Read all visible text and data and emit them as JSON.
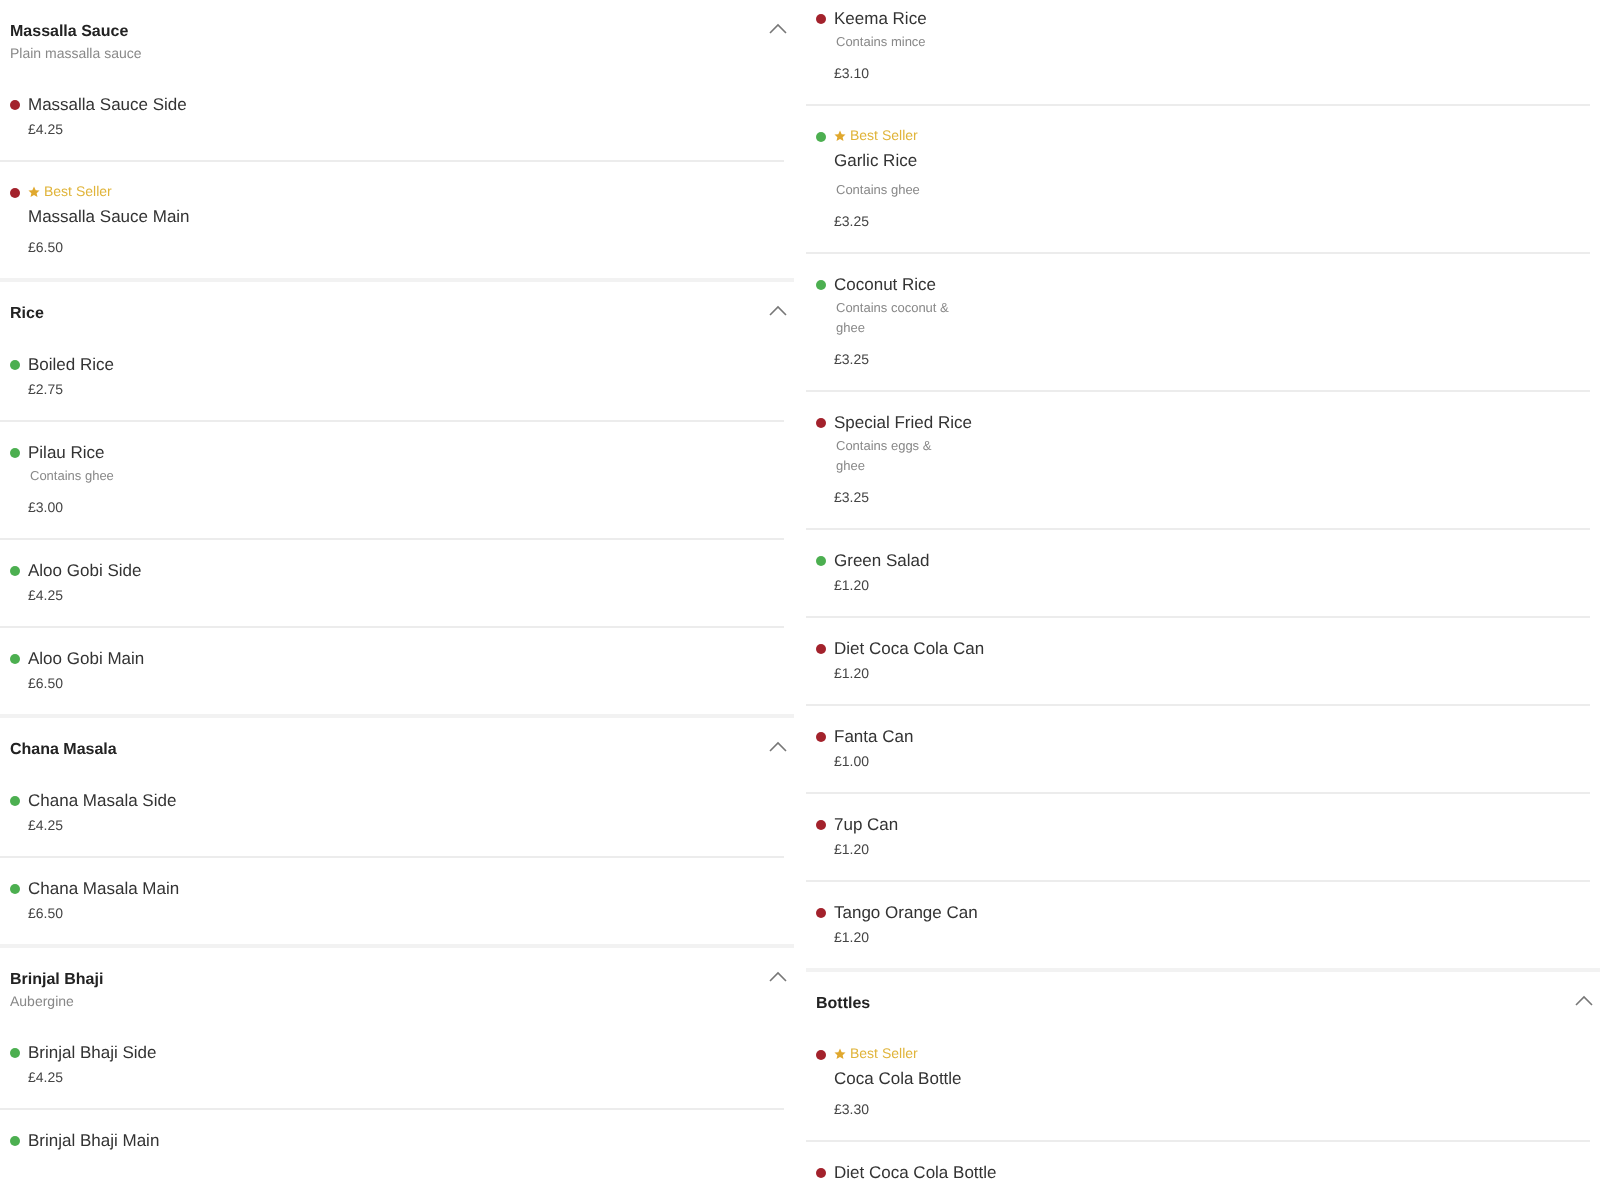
{
  "columns": [
    {
      "sections": [
        {
          "title": "Massalla Sauce",
          "subtitle": "Plain massalla sauce",
          "expanded": true,
          "items": [
            {
              "name": "Massalla Sauce Side",
              "price": "£4.25",
              "color": "#a3222c"
            },
            {
              "name": "Massalla Sauce Main",
              "price": "£6.50",
              "color": "#a3222c",
              "badge": "Best Seller"
            }
          ]
        },
        {
          "title": "Rice",
          "expanded": true,
          "items": [
            {
              "name": "Boiled Rice",
              "price": "£2.75",
              "color": "#4caf50"
            },
            {
              "name": "Pilau Rice",
              "description": "Contains ghee",
              "price": "£3.00",
              "color": "#4caf50"
            },
            {
              "name": "Aloo Gobi Side",
              "price": "£4.25",
              "color": "#4caf50"
            },
            {
              "name": "Aloo Gobi Main",
              "price": "£6.50",
              "color": "#4caf50"
            }
          ]
        },
        {
          "title": "Chana Masala",
          "expanded": true,
          "items": [
            {
              "name": "Chana Masala Side",
              "price": "£4.25",
              "color": "#4caf50"
            },
            {
              "name": "Chana Masala Main",
              "price": "£6.50",
              "color": "#4caf50"
            }
          ]
        },
        {
          "title": "Brinjal Bhaji",
          "subtitle": "Aubergine",
          "expanded": true,
          "items": [
            {
              "name": "Brinjal Bhaji Side",
              "price": "£4.25",
              "color": "#4caf50"
            },
            {
              "name": "Brinjal Bhaji Main",
              "color": "#4caf50"
            }
          ]
        }
      ]
    },
    {
      "sections": [
        {
          "items": [
            {
              "name": "Keema Rice",
              "description": "Contains mince",
              "price": "£3.10",
              "color": "#a3222c"
            },
            {
              "name": "Garlic Rice",
              "description": "Contains ghee",
              "price": "£3.25",
              "color": "#4caf50",
              "badge": "Best Seller"
            },
            {
              "name": "Coconut Rice",
              "description": "Contains coconut & ghee",
              "price": "£3.25",
              "color": "#4caf50"
            },
            {
              "name": "Special Fried Rice",
              "description": "Contains eggs & ghee",
              "price": "£3.25",
              "color": "#a3222c"
            },
            {
              "name": "Green Salad",
              "price": "£1.20",
              "color": "#4caf50"
            },
            {
              "name": "Diet Coca Cola Can",
              "price": "£1.20",
              "color": "#a3222c"
            },
            {
              "name": "Fanta Can",
              "price": "£1.00",
              "color": "#a3222c"
            },
            {
              "name": "7up Can",
              "price": "£1.20",
              "color": "#a3222c"
            },
            {
              "name": "Tango Orange Can",
              "price": "£1.20",
              "color": "#a3222c"
            }
          ]
        },
        {
          "title": "Bottles",
          "expanded": true,
          "items": [
            {
              "name": "Coca Cola Bottle",
              "price": "£3.30",
              "color": "#a3222c",
              "badge": "Best Seller"
            },
            {
              "name": "Diet Coca Cola Bottle",
              "color": "#a3222c"
            }
          ]
        }
      ]
    }
  ]
}
